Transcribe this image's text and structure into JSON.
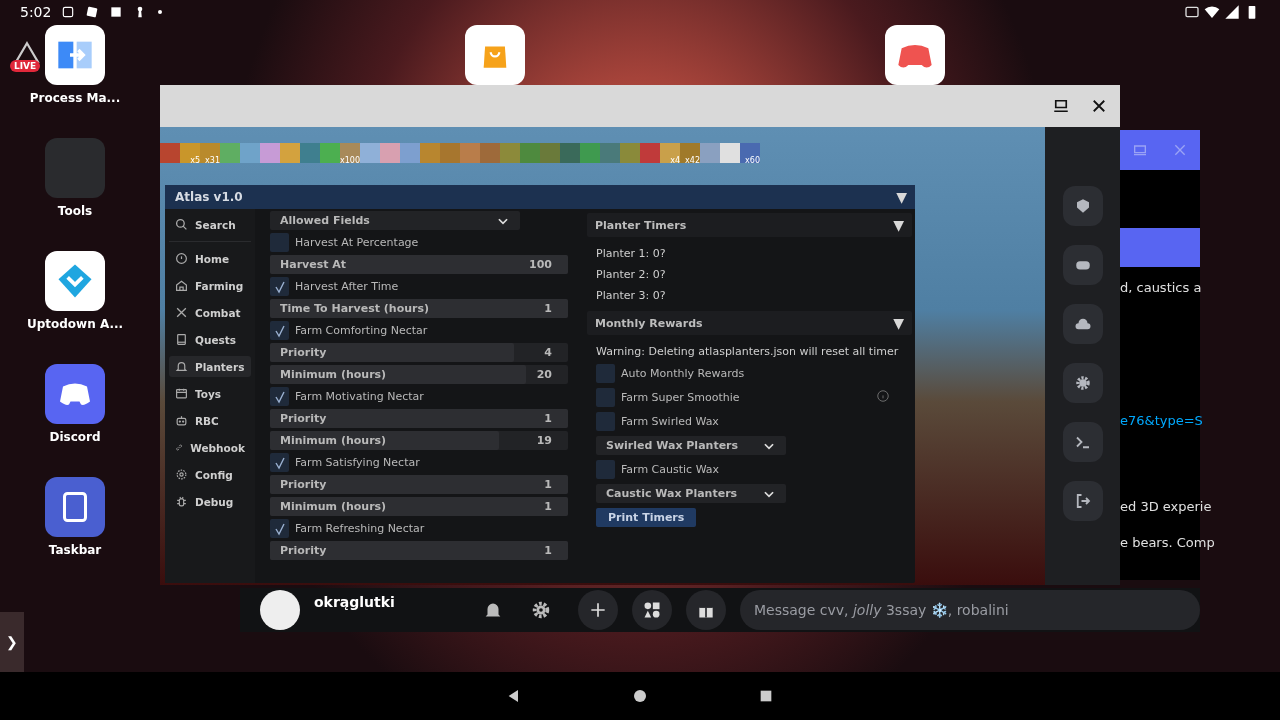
{
  "status_bar": {
    "time": "5:02"
  },
  "live_badge": "LIVE",
  "desktop_icons": [
    {
      "label": "Process Ma...",
      "kind": "process"
    },
    {
      "label": "Tools",
      "kind": "folder"
    },
    {
      "label": "Uptodown A...",
      "kind": "uptodown"
    },
    {
      "label": "Discord",
      "kind": "discord"
    },
    {
      "label": "Taskbar",
      "kind": "taskbar"
    }
  ],
  "top_apps": [
    {
      "kind": "store"
    },
    {
      "kind": "game"
    }
  ],
  "discord_window": {
    "lines": [
      {
        "kind": "text",
        "text": "d, caustics a"
      },
      {
        "kind": "link",
        "text": "e76&type=S"
      },
      {
        "kind": "text",
        "text": "ed 3D experie"
      },
      {
        "kind": "text",
        "text": "e bears. Comp"
      }
    ]
  },
  "game": {
    "hotbar": [
      {
        "color": "#b8452f"
      },
      {
        "color": "#c9962a",
        "count": "x5"
      },
      {
        "color": "#b98a2c",
        "count": "x31"
      },
      {
        "color": "#5fae62"
      },
      {
        "color": "#6fa3c9"
      },
      {
        "color": "#c79bd6"
      },
      {
        "color": "#d3a23e"
      },
      {
        "color": "#3f7f8f"
      },
      {
        "color": "#4caf50"
      },
      {
        "color": "#a88a5a",
        "count": "x100"
      },
      {
        "color": "#8fb0d8"
      },
      {
        "color": "#d8a0b0"
      },
      {
        "color": "#7d9fcf"
      },
      {
        "color": "#b8862f"
      },
      {
        "color": "#a7762e"
      },
      {
        "color": "#b97d4a"
      },
      {
        "color": "#9e6a3a"
      },
      {
        "color": "#8c8a3a"
      },
      {
        "color": "#4e8a3e"
      },
      {
        "color": "#6a7a3a"
      },
      {
        "color": "#3a6a5a"
      },
      {
        "color": "#3f9a4f"
      },
      {
        "color": "#4a7a7a"
      },
      {
        "color": "#8a8a3a"
      },
      {
        "color": "#c03a3a"
      },
      {
        "color": "#c9a04a",
        "count": "x4"
      },
      {
        "color": "#a07a2a",
        "count": "x42"
      },
      {
        "color": "#8aa0c0"
      },
      {
        "color": "#e0e0e0"
      },
      {
        "color": "#4a6ab0",
        "count": "x60"
      }
    ]
  },
  "atlas": {
    "title": "Atlas v1.0",
    "toggle": "▼",
    "nav": [
      {
        "label": "Search",
        "kind": "search",
        "selected": false
      },
      {
        "label": "Home",
        "kind": "home",
        "selected": false
      },
      {
        "label": "Farming",
        "kind": "farming",
        "selected": false
      },
      {
        "label": "Combat",
        "kind": "combat",
        "selected": false
      },
      {
        "label": "Quests",
        "kind": "quests",
        "selected": false
      },
      {
        "label": "Planters",
        "kind": "planters",
        "selected": true
      },
      {
        "label": "Toys",
        "kind": "toys",
        "selected": false
      },
      {
        "label": "RBC",
        "kind": "rbc",
        "selected": false
      },
      {
        "label": "Webhook",
        "kind": "webhook",
        "selected": false
      },
      {
        "label": "Config",
        "kind": "config",
        "selected": false
      },
      {
        "label": "Debug",
        "kind": "debug",
        "selected": false
      }
    ],
    "settings": [
      {
        "kind": "dropdown",
        "label": "Allowed Fields"
      },
      {
        "kind": "checkbox",
        "label": "Harvest At Percentage",
        "checked": false
      },
      {
        "kind": "slider",
        "label": "Harvest At",
        "value": "100",
        "level": 1
      },
      {
        "kind": "checkbox",
        "label": "Harvest After Time",
        "checked": true
      },
      {
        "kind": "slider",
        "label": "Time To Harvest (hours)",
        "value": "1",
        "level": 1
      },
      {
        "kind": "checkbox",
        "label": "Farm Comforting Nectar",
        "checked": true
      },
      {
        "kind": "slider",
        "label": "Priority",
        "value": "4",
        "level": 0.82
      },
      {
        "kind": "slider",
        "label": "Minimum (hours)",
        "value": "20",
        "level": 0.86
      },
      {
        "kind": "checkbox",
        "label": "Farm Motivating Nectar",
        "checked": true
      },
      {
        "kind": "slider",
        "label": "Priority",
        "value": "1",
        "level": 1
      },
      {
        "kind": "slider",
        "label": "Minimum (hours)",
        "value": "19",
        "level": 0.77
      },
      {
        "kind": "checkbox",
        "label": "Farm Satisfying Nectar",
        "checked": true
      },
      {
        "kind": "slider",
        "label": "Priority",
        "value": "1",
        "level": 1
      },
      {
        "kind": "slider",
        "label": "Minimum (hours)",
        "value": "1",
        "level": 1
      },
      {
        "kind": "checkbox",
        "label": "Farm Refreshing Nectar",
        "checked": true
      },
      {
        "kind": "slider",
        "label": "Priority",
        "value": "1",
        "level": 1
      }
    ],
    "sections": [
      {
        "title": "Planter Timers",
        "toggle": "▼",
        "items": [
          {
            "kind": "text",
            "text": "Planter 1: 0?"
          },
          {
            "kind": "text",
            "text": "Planter 2: 0?"
          },
          {
            "kind": "text",
            "text": "Planter 3: 0?"
          }
        ]
      },
      {
        "title": "Monthly Rewards",
        "toggle": "▼",
        "items": [
          {
            "kind": "text",
            "text": "Warning: Deleting atlasplanters.json will reset all timer"
          },
          {
            "kind": "checkbox",
            "label": "Auto Monthly Rewards",
            "checked": false,
            "info": false
          },
          {
            "kind": "checkbox",
            "label": "Farm Super Smoothie",
            "checked": false,
            "info": true
          },
          {
            "kind": "checkbox",
            "label": "Farm Swirled Wax",
            "checked": false,
            "info": false
          },
          {
            "kind": "dropdown",
            "label": "Swirled Wax Planters"
          },
          {
            "kind": "checkbox",
            "label": "Farm Caustic Wax",
            "checked": false,
            "info": false
          },
          {
            "kind": "dropdown",
            "label": "Caustic Wax Planters"
          },
          {
            "kind": "button",
            "label": "Print Timers"
          }
        ]
      }
    ]
  },
  "side_panel": [
    {
      "kind": "badge"
    },
    {
      "kind": "gamepad"
    },
    {
      "kind": "cloud"
    },
    {
      "kind": "settings"
    },
    {
      "kind": "terminal"
    },
    {
      "kind": "exit"
    }
  ],
  "chat_bar": {
    "username": "okrąglutki",
    "placeholder": "Message cvv, *jolly* 3ssay ❄️, robalini"
  },
  "edge_tab": "❯"
}
